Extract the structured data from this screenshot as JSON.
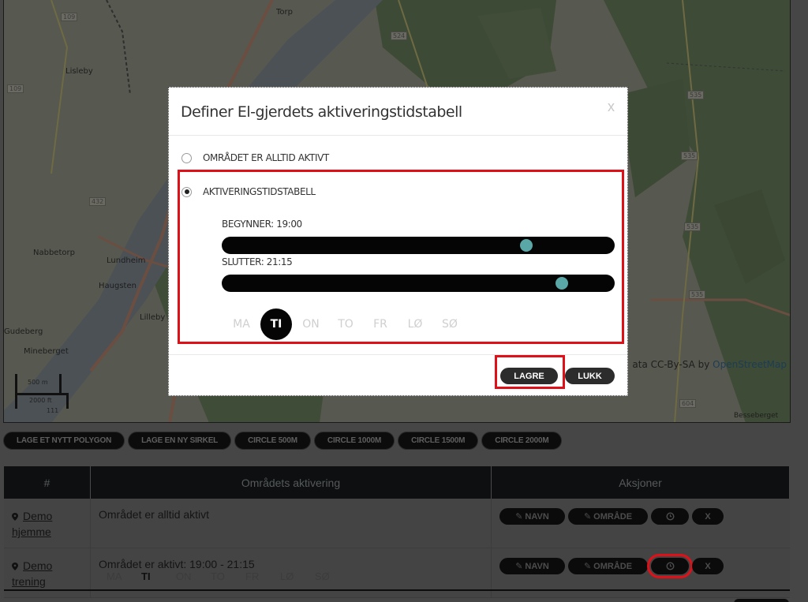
{
  "map": {
    "place_labels": [
      "Torp",
      "Lisleby",
      "Nabbetorp",
      "Lundheim",
      "Haugsten",
      "Lilleby",
      "Gudeberg",
      "Mineberget",
      "Besseberget"
    ],
    "road_shields": [
      "109",
      "109",
      "524",
      "535",
      "535",
      "535",
      "535",
      "432",
      "604",
      "111"
    ],
    "scale": {
      "metric": "500 m",
      "imperial": "2000 ft"
    },
    "attribution_prefix": "ata CC-By-SA by",
    "attribution_link": "OpenStreetMap"
  },
  "modal": {
    "title": "Definer El-gjerdets aktiveringstidstabell",
    "close_label": "x",
    "options": [
      {
        "label": "OMRÅDET ER ALLTID AKTIVT",
        "selected": false
      },
      {
        "label": "AKTIVERINGSTIDSTABELL",
        "selected": true
      }
    ],
    "start": {
      "label": "BEGYNNER: 19:00",
      "value": "19:00",
      "fraction": 0.775
    },
    "end": {
      "label": "SLUTTER: 21:15",
      "value": "21:15",
      "fraction": 0.865
    },
    "days": [
      {
        "label": "MA",
        "active": false
      },
      {
        "label": "TI",
        "active": true
      },
      {
        "label": "ON",
        "active": false
      },
      {
        "label": "TO",
        "active": false
      },
      {
        "label": "FR",
        "active": false
      },
      {
        "label": "LØ",
        "active": false
      },
      {
        "label": "SØ",
        "active": false
      }
    ],
    "save_label": "LAGRE",
    "close_button_label": "LUKK",
    "accent_color": "#5aa7a7",
    "highlight_color": "#e01018"
  },
  "toolbar": {
    "buttons": [
      "LAGE ET NYTT POLYGON",
      "LAGE EN NY SIRKEL",
      "CIRCLE 500M",
      "CIRCLE 1000M",
      "CIRCLE 1500M",
      "CIRCLE 2000M"
    ]
  },
  "table": {
    "headers": [
      "#",
      "Områdets aktivering",
      "Aksjoner"
    ],
    "rows": [
      {
        "name_line1": "Demo",
        "name_line2": "hjemme",
        "activation": "Området er alltid aktivt",
        "days": []
      },
      {
        "name_line1": "Demo",
        "name_line2": "trening",
        "activation": "Området er aktivt: 19:00 - 21:15",
        "days": [
          {
            "label": "MA",
            "active": false
          },
          {
            "label": "TI",
            "active": true
          },
          {
            "label": "ON",
            "active": false
          },
          {
            "label": "TO",
            "active": false
          },
          {
            "label": "FR",
            "active": false
          },
          {
            "label": "LØ",
            "active": false
          },
          {
            "label": "SØ",
            "active": false
          }
        ]
      }
    ],
    "actions": {
      "rename": "NAVN",
      "area": "OMRÅDE",
      "schedule_icon": "clock-icon",
      "delete": "X"
    }
  }
}
